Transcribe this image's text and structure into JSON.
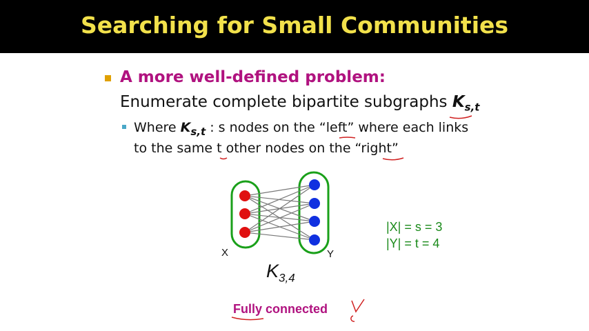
{
  "slide": {
    "title": "Searching for Small Communities",
    "heading": "A more well-defined problem:",
    "line2_text": "Enumerate complete bipartite subgraphs",
    "k_symbol": "K",
    "k_sub": "s,t",
    "line3_where": "Where",
    "line3_rest": ": s nodes on the “left” where each links",
    "line4": "to the same t other nodes on the “right”",
    "set_x_label": "X",
    "set_y_label": "Y",
    "eq1": "|X| = s = 3",
    "eq2": "|Y| = t = 4",
    "k34_symbol": "K",
    "k34_sub": "3,4",
    "fully_connected": "Fully connected"
  },
  "colors": {
    "title": "#f2e14b",
    "heading": "#b0127f",
    "equations": "#1a8a1a",
    "left_nodes": "#e01010",
    "right_nodes": "#1030e0",
    "set_outline": "#1aa01a"
  },
  "icons": [
    "square-bullet-icon",
    "small-square-bullet-icon"
  ]
}
